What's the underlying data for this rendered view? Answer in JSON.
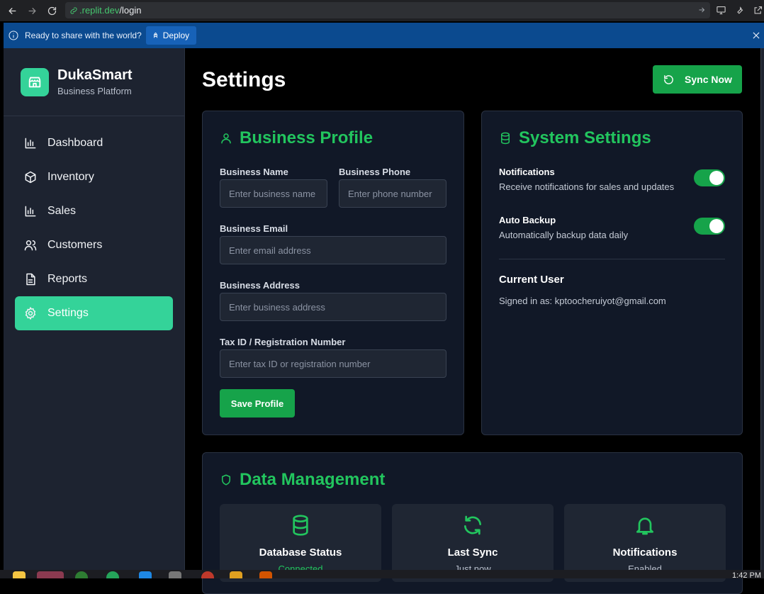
{
  "browser": {
    "url_host": ".replit.dev",
    "url_path": "/login"
  },
  "banner": {
    "message": "Ready to share with the world?",
    "deploy_label": "Deploy"
  },
  "sidebar": {
    "brand_name": "DukaSmart",
    "brand_subtitle": "Business Platform",
    "items": [
      {
        "label": "Dashboard",
        "icon": "bar-chart-icon"
      },
      {
        "label": "Inventory",
        "icon": "box-icon"
      },
      {
        "label": "Sales",
        "icon": "bar-chart-icon"
      },
      {
        "label": "Customers",
        "icon": "users-icon"
      },
      {
        "label": "Reports",
        "icon": "file-icon"
      },
      {
        "label": "Settings",
        "icon": "gear-icon",
        "active": true
      }
    ]
  },
  "page": {
    "title": "Settings",
    "sync_label": "Sync Now"
  },
  "business_profile": {
    "title": "Business Profile",
    "name_label": "Business Name",
    "name_placeholder": "Enter business name",
    "phone_label": "Business Phone",
    "phone_placeholder": "Enter phone number",
    "email_label": "Business Email",
    "email_placeholder": "Enter email address",
    "address_label": "Business Address",
    "address_placeholder": "Enter business address",
    "tax_label": "Tax ID / Registration Number",
    "tax_placeholder": "Enter tax ID or registration number",
    "save_label": "Save Profile"
  },
  "system_settings": {
    "title": "System Settings",
    "notifications_title": "Notifications",
    "notifications_desc": "Receive notifications for sales and updates",
    "notifications_on": true,
    "backup_title": "Auto Backup",
    "backup_desc": "Automatically backup data daily",
    "backup_on": true,
    "current_user_title": "Current User",
    "current_user_text": "Signed in as: kptoocheruiyot@gmail.com"
  },
  "data_management": {
    "title": "Data Management",
    "stats": [
      {
        "title": "Database Status",
        "value": "Connected",
        "value_color": "#22c55e",
        "icon": "database-icon"
      },
      {
        "title": "Last Sync",
        "value": "Just now",
        "value_color": "#b8bfcc",
        "icon": "refresh-icon"
      },
      {
        "title": "Notifications",
        "value": "Enabled",
        "value_color": "#b8bfcc",
        "icon": "bell-icon"
      }
    ]
  },
  "taskbar": {
    "time": "1:42 PM"
  },
  "colors": {
    "accent": "#22c55e",
    "button": "#16a34a",
    "sidebar_active": "#34d399"
  }
}
